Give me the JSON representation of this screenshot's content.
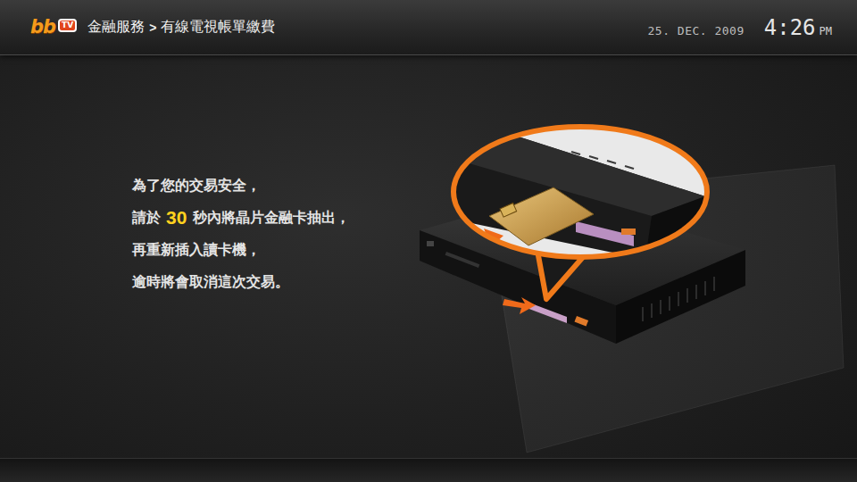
{
  "logo": {
    "text": "bb",
    "badge": "TV"
  },
  "breadcrumb": {
    "separator": ">",
    "items": [
      {
        "label": "金融服務"
      },
      {
        "label": "有線電視帳單繳費"
      }
    ]
  },
  "clock": {
    "date": "25. DEC. 2009",
    "time": "4:26",
    "ampm": "PM"
  },
  "message": {
    "lines": [
      [
        {
          "text": "為了您的交易安全，",
          "highlight": false
        }
      ],
      [
        {
          "text": "請於",
          "highlight": false
        },
        {
          "text": "30",
          "highlight": true
        },
        {
          "text": "秒內將晶片金融卡抽出，",
          "highlight": false
        }
      ],
      [
        {
          "text": "再重新插入讀卡機，",
          "highlight": false
        }
      ],
      [
        {
          "text": "逾時將會取消這次交易。",
          "highlight": false
        }
      ]
    ]
  }
}
